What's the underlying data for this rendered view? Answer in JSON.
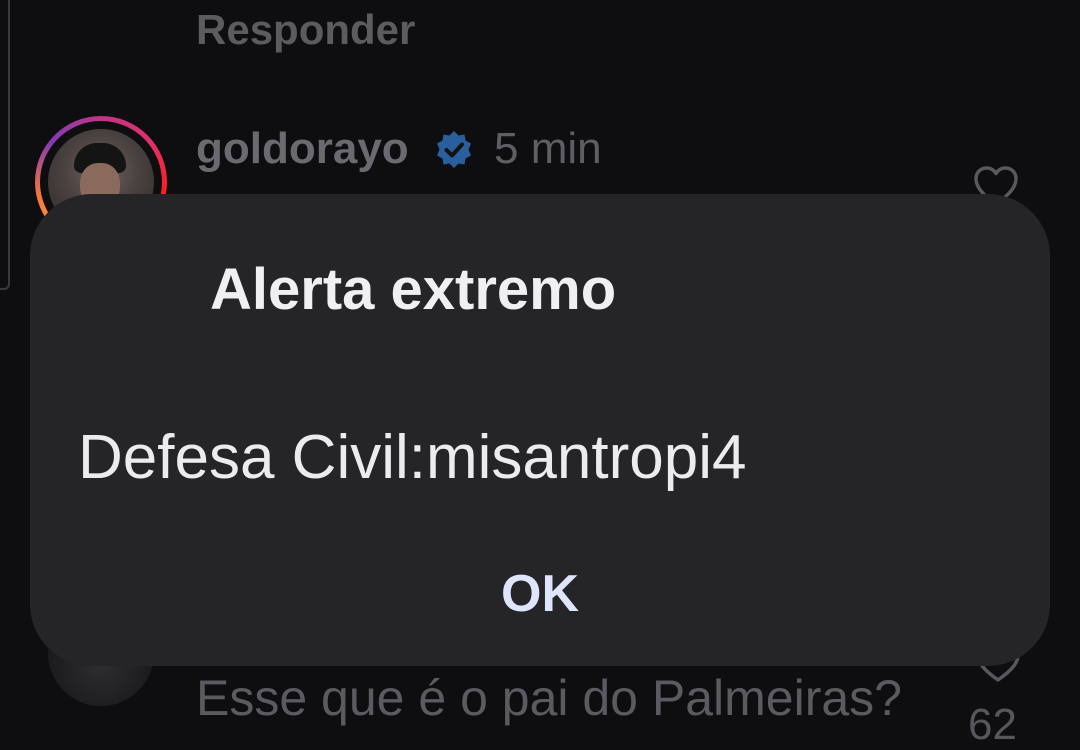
{
  "thread": {
    "reply_label": "Responder",
    "comment": {
      "username": "goldorayo",
      "time": "5 min"
    },
    "next_comment": {
      "text": "Esse que é o pai do Palmeiras?",
      "like_count": "62"
    }
  },
  "alert": {
    "title": "Alerta extremo",
    "message": "Defesa Civil:misantropi4",
    "ok_label": "OK"
  },
  "colors": {
    "dialog_bg": "#252527",
    "ok_text": "#dfe4ff",
    "verified_badge": "#3797f0",
    "background": "#0e0e10"
  },
  "icons": {
    "verified": "verified-badge-icon",
    "like": "heart-icon"
  }
}
